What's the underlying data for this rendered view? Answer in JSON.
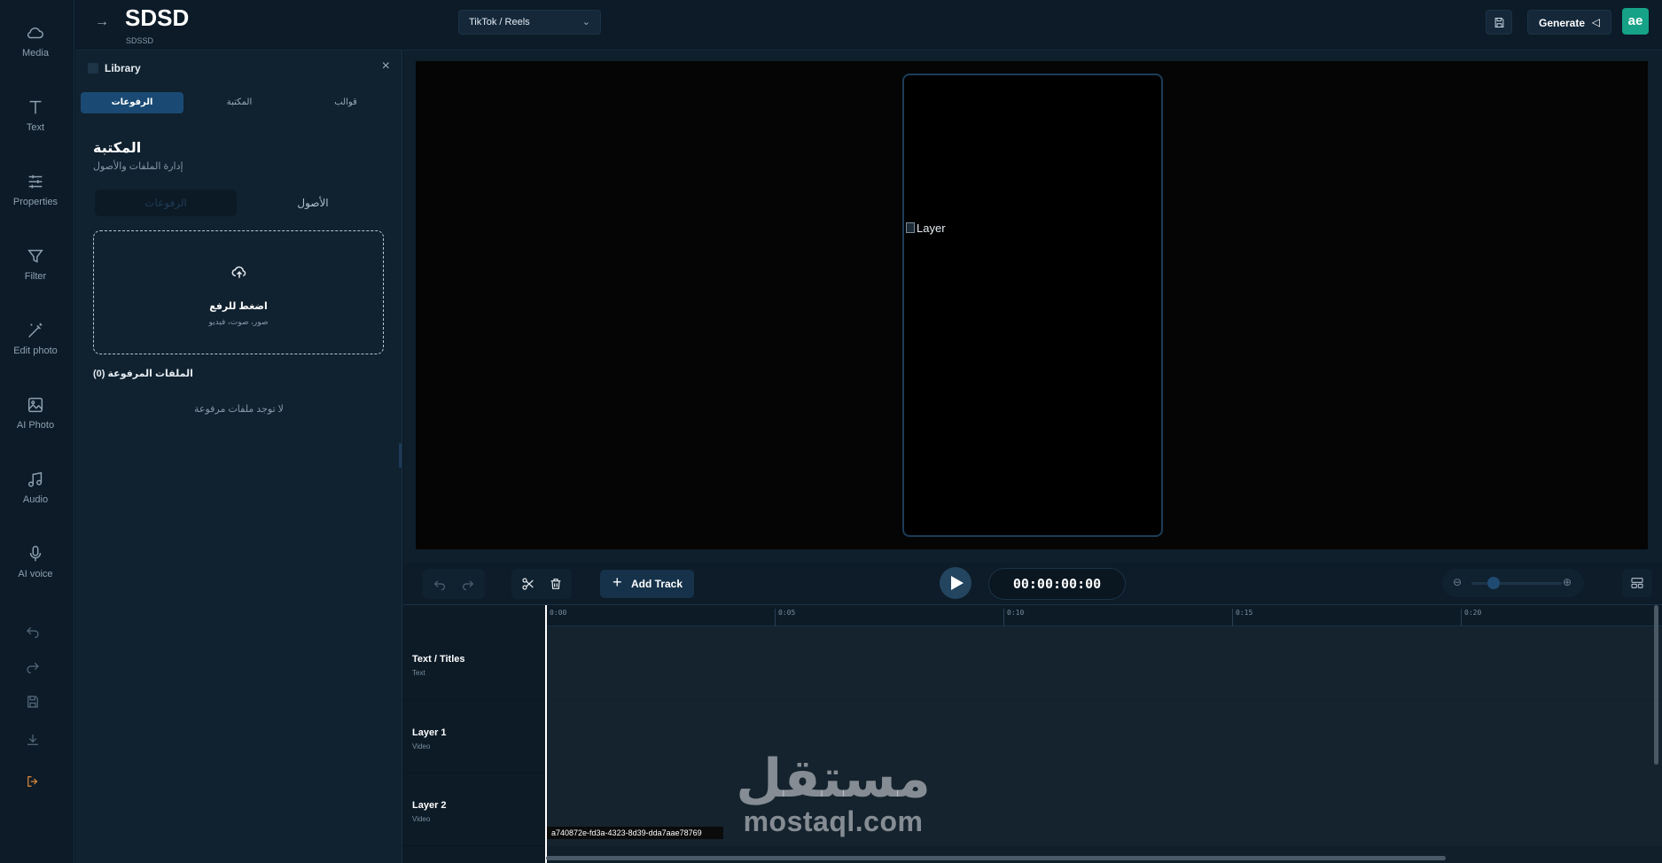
{
  "app": {
    "title": "SDSD",
    "subtitle": "SDSSD"
  },
  "rail": {
    "items": [
      {
        "label": "Media",
        "icon": "cloud-icon"
      },
      {
        "label": "Text",
        "icon": "text-icon"
      },
      {
        "label": "Properties",
        "icon": "sliders-icon"
      },
      {
        "label": "Filter",
        "icon": "filter-icon"
      },
      {
        "label": "Edit photo",
        "icon": "magic-wand-icon"
      },
      {
        "label": "AI Photo",
        "icon": "image-icon"
      },
      {
        "label": "Audio",
        "icon": "music-icon"
      },
      {
        "label": "AI voice",
        "icon": "microphone-icon"
      }
    ]
  },
  "header": {
    "format": "TikTok / Reels",
    "generate_label": "Generate",
    "avatar_text": "ae"
  },
  "library": {
    "title": "Library",
    "tabs": [
      "الرفوعات",
      "المكتبة",
      "قوالب"
    ],
    "heading": "المكتبة",
    "subheading": "إدارة الملفات والأصول",
    "subtabs": [
      "الرفوعات",
      "الأصول"
    ],
    "upload_title": "اضغط للرفع",
    "upload_hint": "صور، صوت، فيديو",
    "files_title": "الملفات المرفوعة (0)",
    "empty": "لا توجد ملفات مرفوعة"
  },
  "preview": {
    "image_alt": "Layer"
  },
  "controls": {
    "add_track": "Add Track",
    "timecode": "00:00:00:00"
  },
  "timeline": {
    "ticks": [
      "0:00",
      "0:05",
      "0:10",
      "0:15",
      "0:20"
    ],
    "tracks": [
      {
        "name": "Text / Titles",
        "kind": "Text"
      },
      {
        "name": "Layer 1",
        "kind": "Video"
      },
      {
        "name": "Layer 2",
        "kind": "Video"
      }
    ],
    "clip_label": "a740872e-fd3a-4323-8d39-dda7aae78769"
  },
  "watermark": {
    "arabic": "مستقل",
    "latin": "mostaql.com"
  },
  "colors": {
    "accent": "#1a4a73",
    "background": "#0b1a26",
    "avatar": "#16a286"
  }
}
